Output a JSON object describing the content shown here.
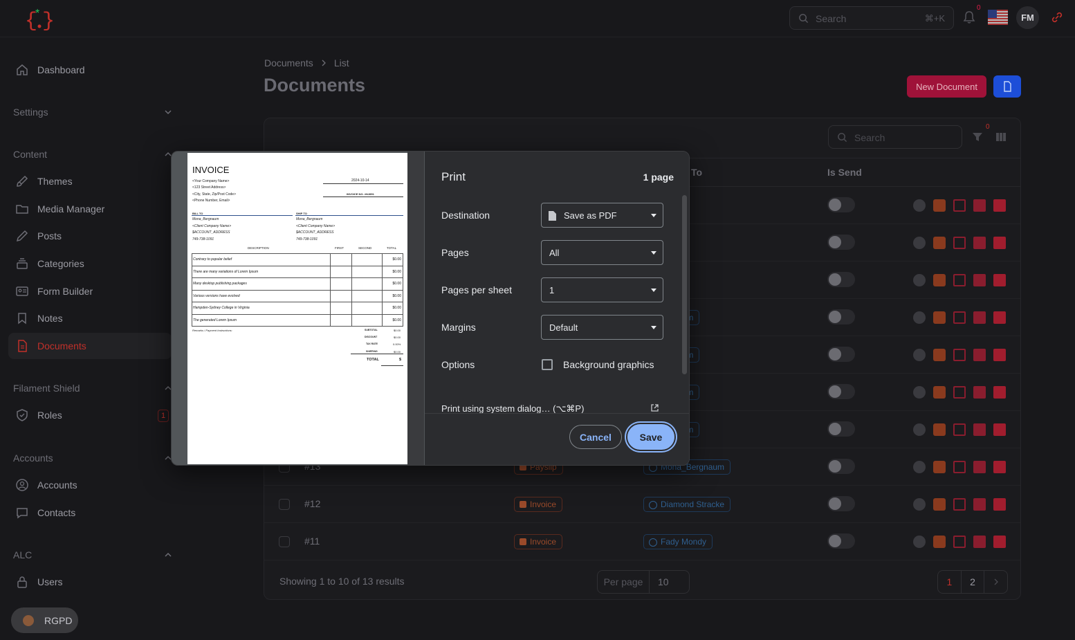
{
  "colors": {
    "accent": "#c2302a",
    "primary_blue": "#1d4ed8",
    "dialog_bg": "#2b2c2f",
    "save_blue": "#8ab4f8"
  },
  "topbar": {
    "search_placeholder": "Search",
    "search_shortcut": "⌘+K",
    "notif_count": "0",
    "user_initials": "FM"
  },
  "sidebar": {
    "dashboard": "Dashboard",
    "settings_group": "Settings",
    "content_group": "Content",
    "themes": "Themes",
    "media": "Media Manager",
    "posts": "Posts",
    "categories": "Categories",
    "form_builder": "Form Builder",
    "notes": "Notes",
    "documents": "Documents",
    "shield_group": "Filament Shield",
    "roles": "Roles",
    "roles_badge": "1",
    "accounts_group": "Accounts",
    "accounts": "Accounts",
    "contacts": "Contacts",
    "alc_group": "ALC",
    "users": "Users",
    "rgpd": "RGPD"
  },
  "main": {
    "breadcrumb": [
      "Documents",
      "List"
    ],
    "title": "Documents",
    "new_button": "New Document",
    "table_search_placeholder": "Search",
    "filter_count": "0",
    "columns": {
      "to": "To",
      "is_send": "Is Send"
    },
    "rows": [
      {
        "num": "#13",
        "type": "Payslip",
        "to": "Mona_Bergnaum"
      },
      {
        "num": "#12",
        "type": "Invoice",
        "to": "Diamond Stracke"
      },
      {
        "num": "#11",
        "type": "Invoice",
        "to": "Fady Mondy"
      }
    ],
    "partial_to": [
      "monis",
      "ergnaum",
      "ergnaum",
      "ergnaum",
      "ergnaum"
    ],
    "footer_text": "Showing 1 to 10 of 13 results",
    "per_page_label": "Per page",
    "per_page_value": "10",
    "pages": [
      "1",
      "2"
    ]
  },
  "print_dialog": {
    "title": "Print",
    "page_count": "1 page",
    "destination_label": "Destination",
    "destination_value": "Save as PDF",
    "pages_label": "Pages",
    "pages_value": "All",
    "pps_label": "Pages per sheet",
    "pps_value": "1",
    "margins_label": "Margins",
    "margins_value": "Default",
    "options_label": "Options",
    "bg_graphics_label": "Background graphics",
    "system_dialog": "Print using system dialog… (⌥⌘P)",
    "cancel": "Cancel",
    "save": "Save"
  },
  "invoice": {
    "title": "INVOICE",
    "company": "<Your Company Name>",
    "street": "<123 Street Address>",
    "city": "<City, State, Zip/Post Code>",
    "phone": "<Phone Number, Email>",
    "date": "2024-10-14",
    "invoice_no": "INVOICE NO. #NJ851",
    "bill_to": "BILL TO",
    "ship_to": "SHIP TO",
    "bill_name": "Mona_Bergnaum",
    "bill_company": "<Client Company Name>",
    "bill_address": "$ACCOUNT_ADDRESS",
    "bill_phone": "749-738-1091",
    "ship_name": "Mona_Bergnaum",
    "ship_company": "<Client Company Name>",
    "ship_address": "$ACCOUNT_ADDRESS",
    "ship_phone": "749-738-1091",
    "col_description": "DESCRIPTION",
    "col_first": "FIRST",
    "col_second": "SECOND",
    "col_total": "TOTAL",
    "items": [
      {
        "desc": "Contrary to popular belief",
        "total": "$0.00"
      },
      {
        "desc": "There are many variations of Lorem Ipsum",
        "total": "$0.00"
      },
      {
        "desc": "Many desktop publishing packages",
        "total": "$0.00"
      },
      {
        "desc": "Various versions have evolved",
        "total": "$0.00"
      },
      {
        "desc": "Hampden-Sydney College in Virginia",
        "total": "$0.00"
      },
      {
        "desc": "The generated Lorem Ipsum",
        "total": "$0.00"
      }
    ],
    "remarks": "Remarks / Payment Instructions:",
    "subtotal_label": "SUBTOTAL",
    "subtotal": "$0.00",
    "discount_label": "DISCOUNT",
    "discount": "$0.00",
    "taxrate_label": "TAX RATE",
    "taxrate": "0.00%",
    "shipping_label": "SHIPPING",
    "shipping": "$0.00",
    "total_label": "TOTAL",
    "total": "$"
  }
}
